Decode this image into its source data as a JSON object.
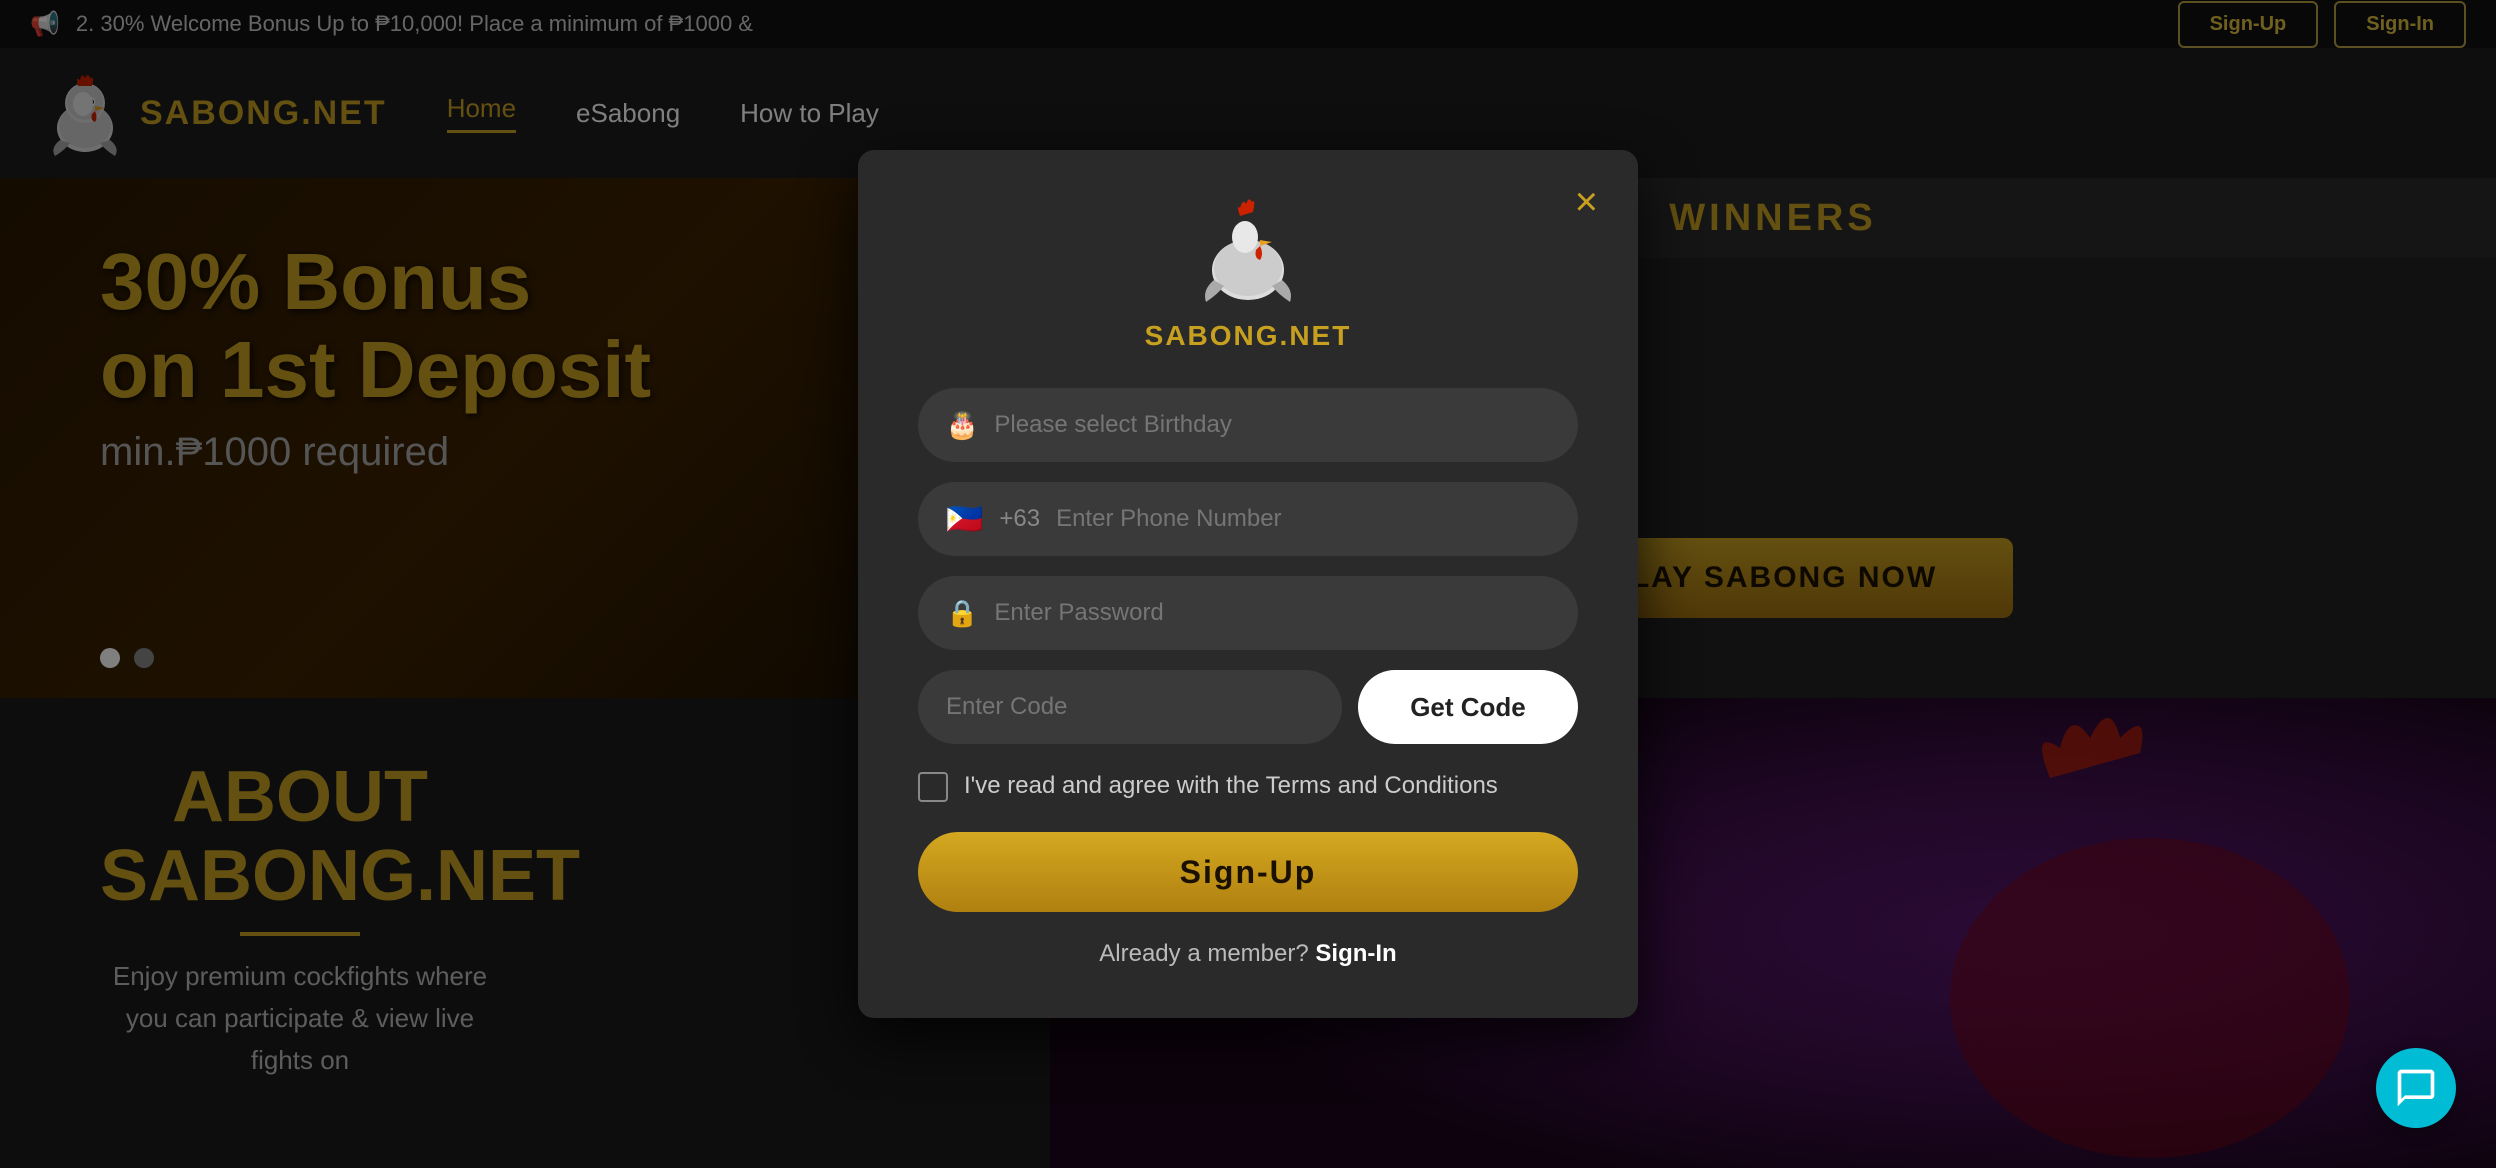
{
  "announcement": {
    "icon": "📢",
    "text": "2. 30% Welcome Bonus Up to ₱10,000! Place a minimum of ₱1000 &",
    "signup_label": "Sign-Up",
    "signin_label": "Sign-In"
  },
  "header": {
    "logo_text": "SABONG.NET",
    "nav": [
      {
        "label": "Home",
        "active": true
      },
      {
        "label": "eSabong",
        "active": false
      },
      {
        "label": "How to Play",
        "active": false
      }
    ]
  },
  "banner": {
    "title_line1": "30% Bonus",
    "title_line2": "on 1st Deposit",
    "subtitle": "min.₱1000 required"
  },
  "about": {
    "title_line1": "ABOUT",
    "title_line2": "SABONG.NET",
    "text": "Enjoy premium cockfights where you\ncan participate & view live fights on"
  },
  "winners": {
    "title": "WINNERS"
  },
  "play_now": {
    "label": "PLAY SABONG NOW"
  },
  "modal": {
    "logo_text": "SABONG.NET",
    "close_label": "×",
    "birthday_placeholder": "Please select Birthday",
    "phone_flag": "🇵🇭",
    "phone_code": "+63",
    "phone_placeholder": "Enter Phone Number",
    "password_placeholder": "Enter Password",
    "code_placeholder": "Enter Code",
    "get_code_label": "Get Code",
    "terms_text": "I've read and agree with the Terms and Conditions",
    "signup_label": "Sign-Up",
    "already_member_text": "Already a member?",
    "signin_link": "Sign-In"
  },
  "chat": {
    "icon": "chat-icon"
  }
}
